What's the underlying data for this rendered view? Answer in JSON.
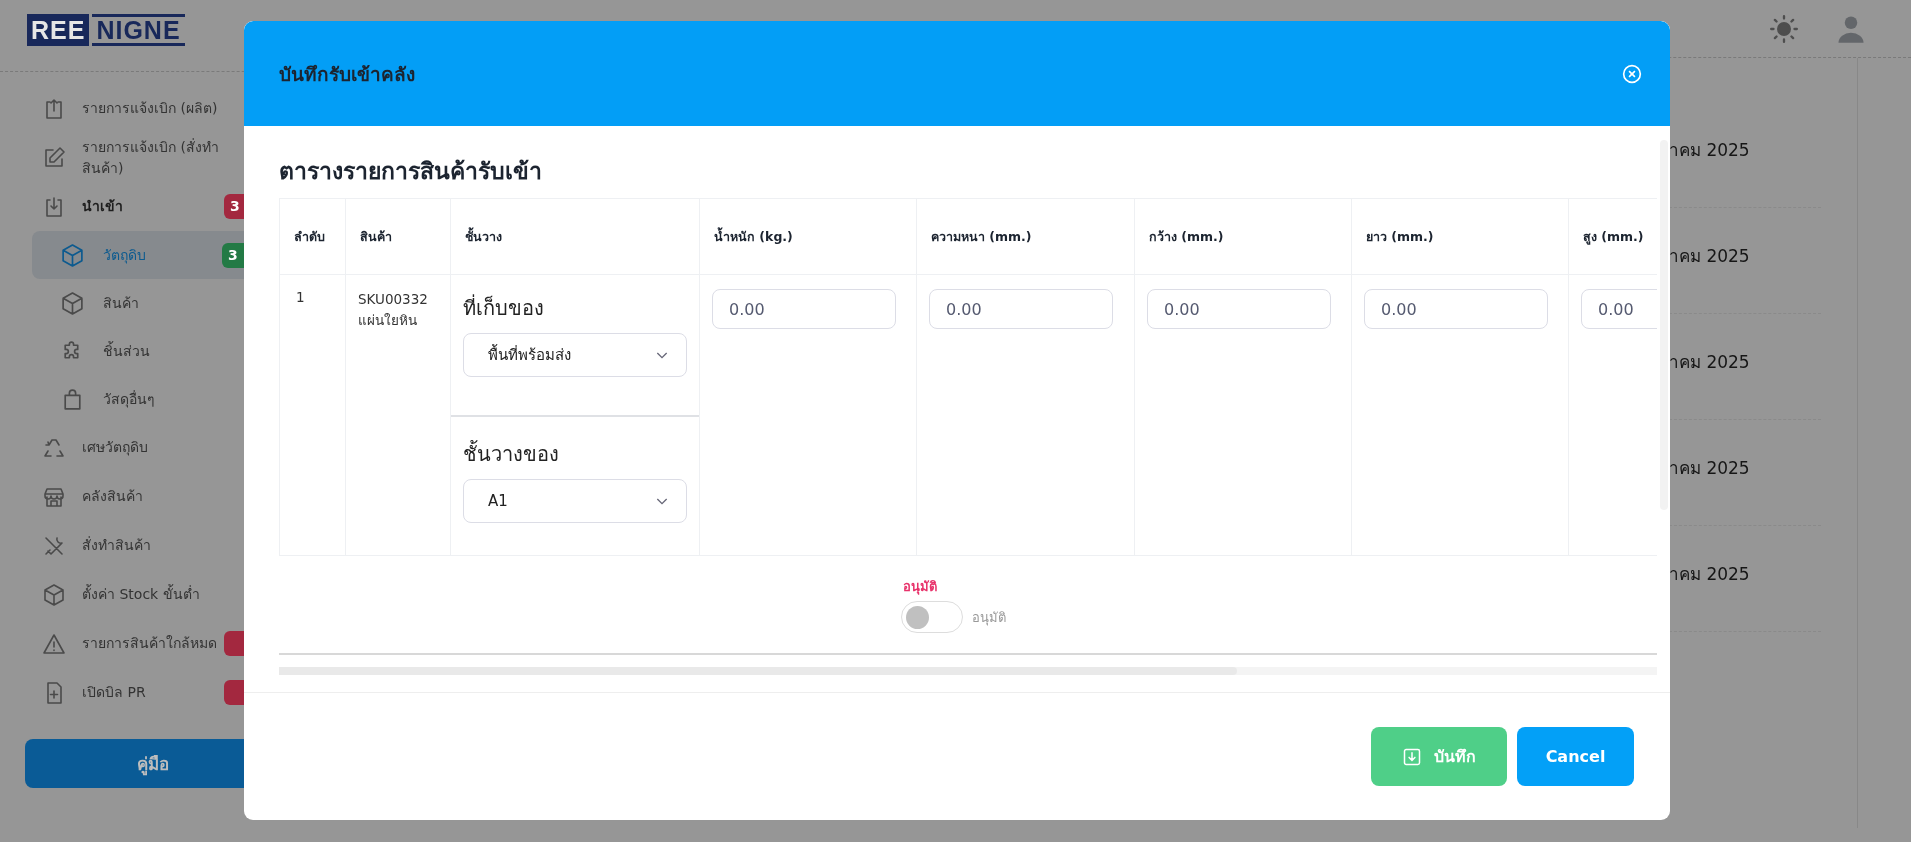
{
  "logo": {
    "parts": [
      "REE",
      "NIGNE"
    ]
  },
  "sidebar": {
    "items": [
      {
        "label": "รายการแจ้งเบิก (ผลิต)",
        "selected": false
      },
      {
        "label": "รายการแจ้งเบิก (สั่งทำสินค้า)",
        "selected": false
      },
      {
        "label": "นำเข้า",
        "selected": false,
        "badge": {
          "text": "3",
          "color": "#a3283f"
        },
        "children": [
          {
            "label": "วัตถุดิบ",
            "selected": true,
            "badge": {
              "text": "3",
              "color": "#237a45"
            }
          },
          {
            "label": "สินค้า",
            "selected": false
          },
          {
            "label": "ชิ้นส่วน",
            "selected": false
          },
          {
            "label": "วัสดุอื่นๆ",
            "selected": false
          }
        ]
      },
      {
        "label": "เศษวัตถุดิบ",
        "selected": false
      },
      {
        "label": "คลังสินค้า",
        "selected": false
      },
      {
        "label": "สั่งทำสินค้า",
        "selected": false
      },
      {
        "label": "ตั้งค่า Stock ขั้นต่ำ",
        "selected": false
      },
      {
        "label": "รายการสินค้าใกล้หมด",
        "selected": false,
        "badge": {
          "color": "#a3283f"
        }
      },
      {
        "label": "เปิดบิล PR",
        "selected": false,
        "badge": {
          "color": "#a3283f"
        }
      }
    ],
    "manual_button": "คู่มือ"
  },
  "background_rows": [
    "าคม 2025",
    "าคม 2025",
    "าคม 2025",
    "าคม 2025",
    "าคม 2025"
  ],
  "modal": {
    "title": "บันทึกรับเข้าคลัง",
    "table_title": "ตารางรายการสินค้ารับเข้า",
    "columns": [
      "ลำดับ",
      "สินค้า",
      "ชั้นวาง",
      "น้ำหนัก (kg.)",
      "ความหนา (mm.)",
      "กว้าง (mm.)",
      "ยาว (mm.)",
      "สูง (mm.)"
    ],
    "rows": [
      {
        "no": "1",
        "product": "SKU00332\nแผ่นใยหิน",
        "storage_label": "ที่เก็บของ",
        "storage_value": "พื้นที่พร้อมส่ง",
        "shelf_label": "ชั้นวางของ",
        "shelf_value": "A1",
        "measurements": [
          "0.00",
          "0.00",
          "0.00",
          "0.00",
          "0.00"
        ]
      }
    ],
    "approval": {
      "heading": "อนุมัติ",
      "label": "อนุมัติ",
      "on": false
    },
    "buttons": [
      {
        "label": "บันทึก",
        "kind": "save"
      },
      {
        "label": "Cancel",
        "kind": "cancel"
      }
    ]
  }
}
